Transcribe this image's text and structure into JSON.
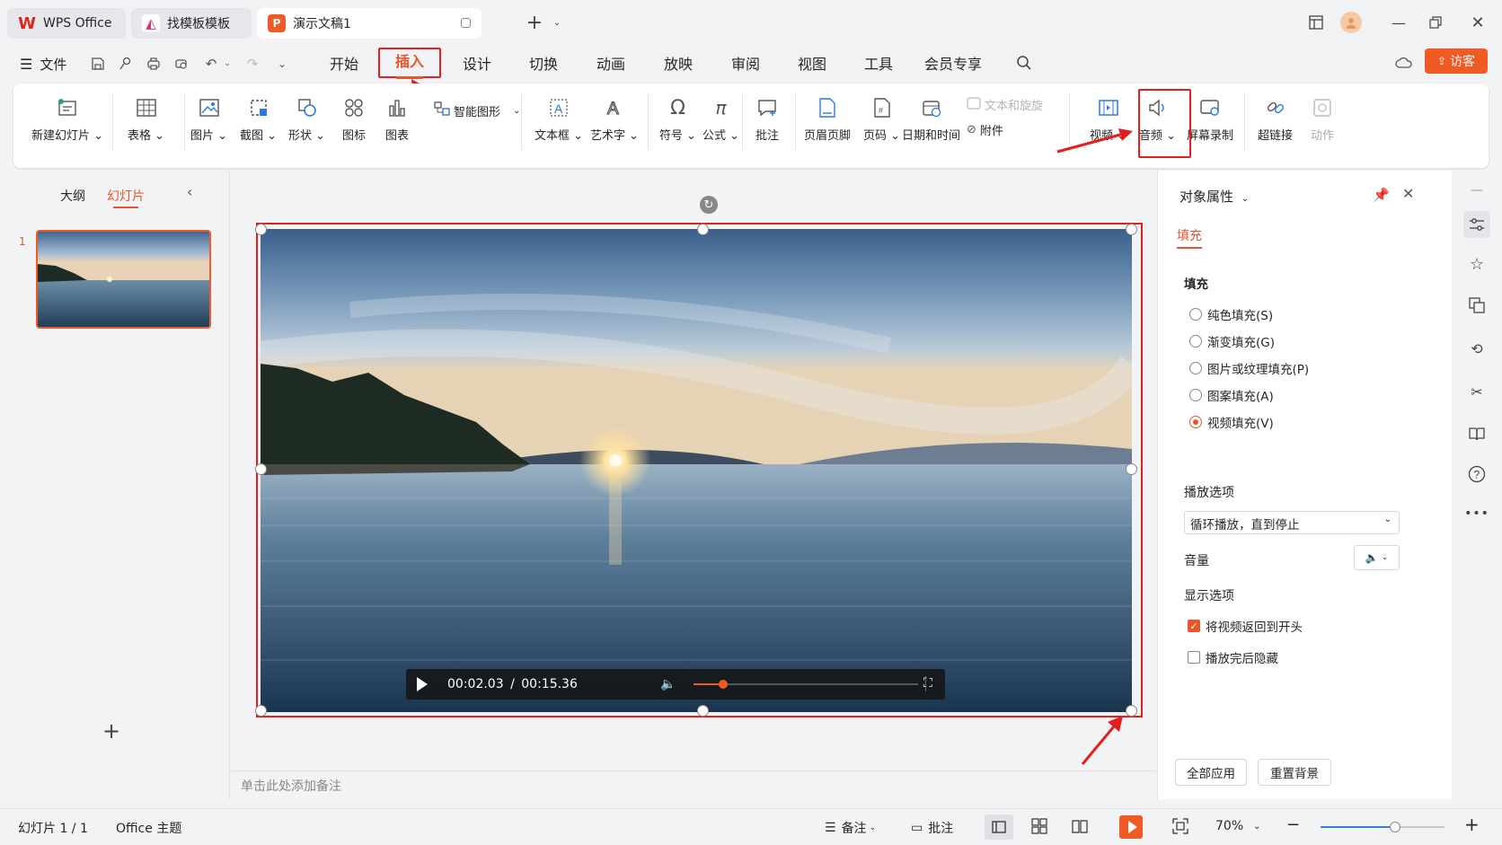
{
  "tabs": [
    {
      "label": "WPS Office",
      "icon": "wps-logo-icon"
    },
    {
      "label": "找模板模板",
      "icon": "template-icon"
    },
    {
      "label": "演示文稿1",
      "icon": "presentation-icon"
    }
  ],
  "menu": {
    "file_label": "文件",
    "items": [
      "开始",
      "插入",
      "设计",
      "切换",
      "动画",
      "放映",
      "审阅",
      "视图",
      "工具",
      "会员专享"
    ],
    "active": "插入",
    "visit_label": "访客"
  },
  "ribbon": {
    "new_slide": "新建幻灯片",
    "table": "表格",
    "picture": "图片",
    "screenshot": "截图",
    "shape": "形状",
    "icon": "图标",
    "chart": "图表",
    "smartart": "智能图形",
    "textbox": "文本框",
    "wordart": "艺术字",
    "symbol": "符号",
    "formula": "公式",
    "comment": "批注",
    "header_footer": "页眉页脚",
    "page_number": "页码",
    "datetime": "日期和时间",
    "text_speech": "文本和旋旋",
    "attachment": "附件",
    "video": "视频",
    "audio": "音频",
    "screen_record": "屏幕录制",
    "hyperlink": "超链接",
    "action": "动作"
  },
  "left_panel": {
    "outline_tab": "大纲",
    "slides_tab": "幻灯片",
    "slide_number": "1"
  },
  "video": {
    "current_time": "00:02.03",
    "total_time": "00:15.36",
    "time_separator": "/",
    "progress": 0.13
  },
  "notes_placeholder": "单击此处添加备注",
  "right_panel": {
    "title": "对象属性",
    "tab_fill": "填充",
    "fill_section": "填充",
    "fill_options": [
      {
        "label": "纯色填充(S)",
        "selected": false
      },
      {
        "label": "渐变填充(G)",
        "selected": false
      },
      {
        "label": "图片或纹理填充(P)",
        "selected": false
      },
      {
        "label": "图案填充(A)",
        "selected": false
      },
      {
        "label": "视频填充(V)",
        "selected": true
      }
    ],
    "play_section": "播放选项",
    "play_mode": "循环播放，直到停止",
    "volume_label": "音量",
    "display_section": "显示选项",
    "rewind_label": "将视频返回到开头",
    "rewind_checked": true,
    "hide_label": "播放完后隐藏",
    "hide_checked": false,
    "apply_all": "全部应用",
    "reset_bg": "重置背景"
  },
  "status": {
    "slide_info": "幻灯片 1 / 1",
    "theme": "Office 主题",
    "notes": "备注",
    "comments": "批注",
    "zoom": "70%",
    "zoom_fraction": 0.6
  },
  "colors": {
    "accent": "#e8552c",
    "highlight_red": "#e21f1f"
  }
}
